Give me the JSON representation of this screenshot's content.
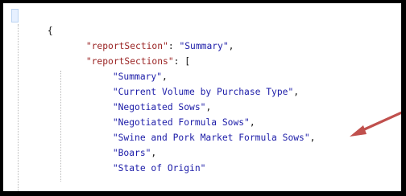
{
  "editor": {
    "lines": [
      {
        "indent": 0,
        "text": "{"
      },
      {
        "indent": 1,
        "key": "\"reportSection\"",
        "sep": ": ",
        "value": "\"Summary\"",
        "trail": ","
      },
      {
        "indent": 1,
        "key": "\"reportSections\"",
        "sep": ": ",
        "trail": "["
      },
      {
        "indent": 2,
        "value": "\"Summary\"",
        "trail": ","
      },
      {
        "indent": 2,
        "value": "\"Current Volume by Purchase Type\"",
        "trail": ","
      },
      {
        "indent": 2,
        "value": "\"Negotiated Sows\"",
        "trail": ","
      },
      {
        "indent": 2,
        "value": "\"Negotiated Formula Sows\"",
        "trail": ","
      },
      {
        "indent": 2,
        "value": "\"Swine and Pork Market Formula Sows\"",
        "trail": ","
      },
      {
        "indent": 2,
        "value": "\"Boars\"",
        "trail": ","
      },
      {
        "indent": 2,
        "value": "\"State of Origin\""
      },
      {
        "indent": 1,
        "text": "],"
      }
    ]
  },
  "annotation": {
    "arrow_color": "#c0504d",
    "arrow_icon": "arrow-icon"
  },
  "colors": {
    "key": "#9a2323",
    "string": "#1c1ca8",
    "punctuation": "#111111",
    "frame": "#000000"
  }
}
